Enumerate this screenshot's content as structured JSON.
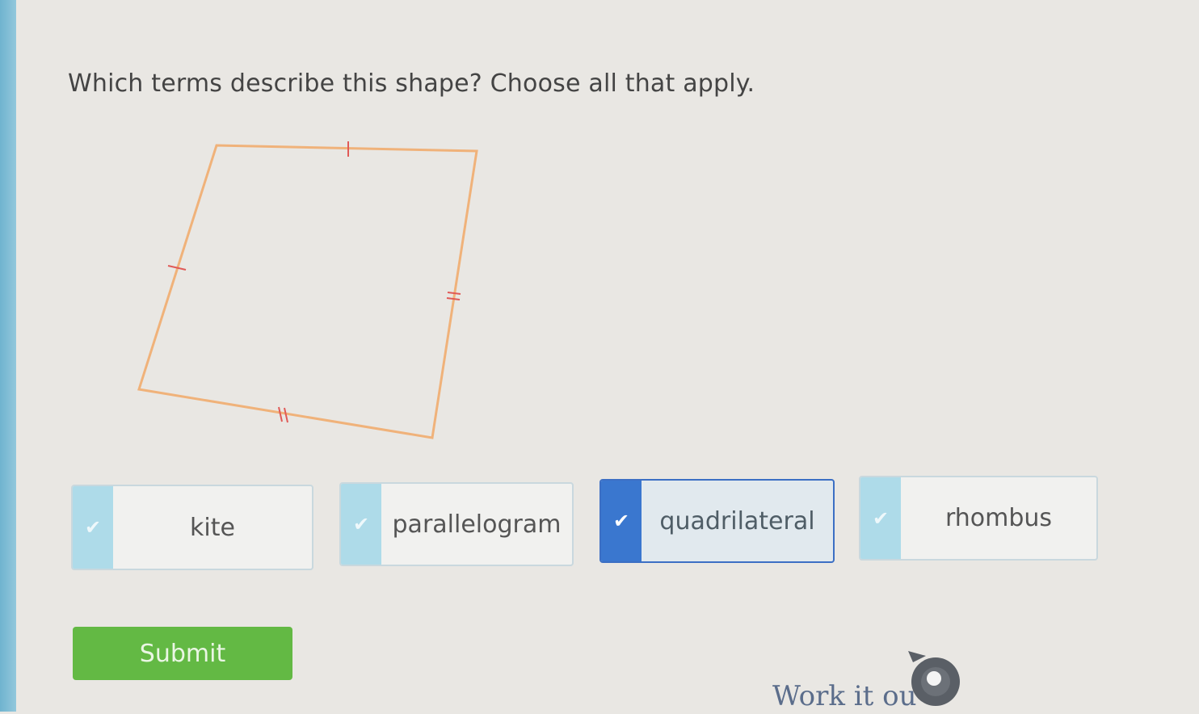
{
  "question": {
    "text": "Which terms describe this shape? Choose all that apply."
  },
  "shape": {
    "side_marks": [
      "single-tick",
      "single-tick",
      "double-tick",
      "double-tick"
    ],
    "outline_color": "#f0b27a",
    "mark_color": "#e05a57"
  },
  "choices": [
    {
      "label": "kite",
      "selected": false
    },
    {
      "label": "parallelogram",
      "selected": false
    },
    {
      "label": "quadrilateral",
      "selected": true
    },
    {
      "label": "rhombus",
      "selected": false
    }
  ],
  "submit": {
    "label": "Submit"
  },
  "help": {
    "label": "Work it ou",
    "icon": "work-it-out-icon"
  },
  "colors": {
    "accent": "#3a77cf",
    "submit": "#63b944",
    "check_bg": "#aedbe9"
  }
}
